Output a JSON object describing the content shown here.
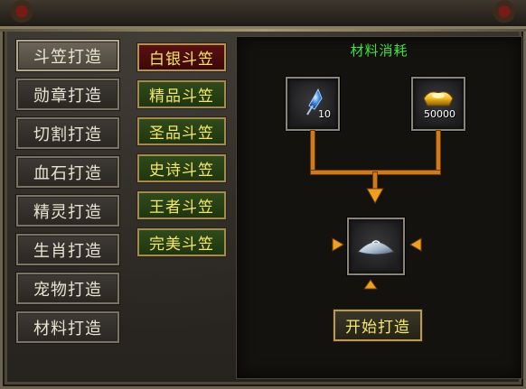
{
  "nav": {
    "items": [
      {
        "label": "斗笠打造",
        "active": true
      },
      {
        "label": "勋章打造",
        "active": false
      },
      {
        "label": "切割打造",
        "active": false
      },
      {
        "label": "血石打造",
        "active": false
      },
      {
        "label": "精灵打造",
        "active": false
      },
      {
        "label": "生肖打造",
        "active": false
      },
      {
        "label": "宠物打造",
        "active": false
      },
      {
        "label": "材料打造",
        "active": false
      }
    ]
  },
  "list": {
    "items": [
      {
        "label": "白银斗笠",
        "selected": true
      },
      {
        "label": "精品斗笠",
        "selected": false
      },
      {
        "label": "圣品斗笠",
        "selected": false
      },
      {
        "label": "史诗斗笠",
        "selected": false
      },
      {
        "label": "王者斗笠",
        "selected": false
      },
      {
        "label": "完美斗笠",
        "selected": false
      }
    ]
  },
  "panel": {
    "title": "材料消耗",
    "materials": [
      {
        "icon": "crystal-icon",
        "qty": "10"
      },
      {
        "icon": "gold-ingot-icon",
        "qty": "50000"
      }
    ],
    "result_icon": "hat-icon",
    "start_label": "开始打造"
  },
  "colors": {
    "title_green": "#41e13b",
    "button_text_yellow": "#f5e76b",
    "pipe_orange": "#d17a1c",
    "selected_red": "#5a1010",
    "item_green": "#2f4a1a"
  }
}
